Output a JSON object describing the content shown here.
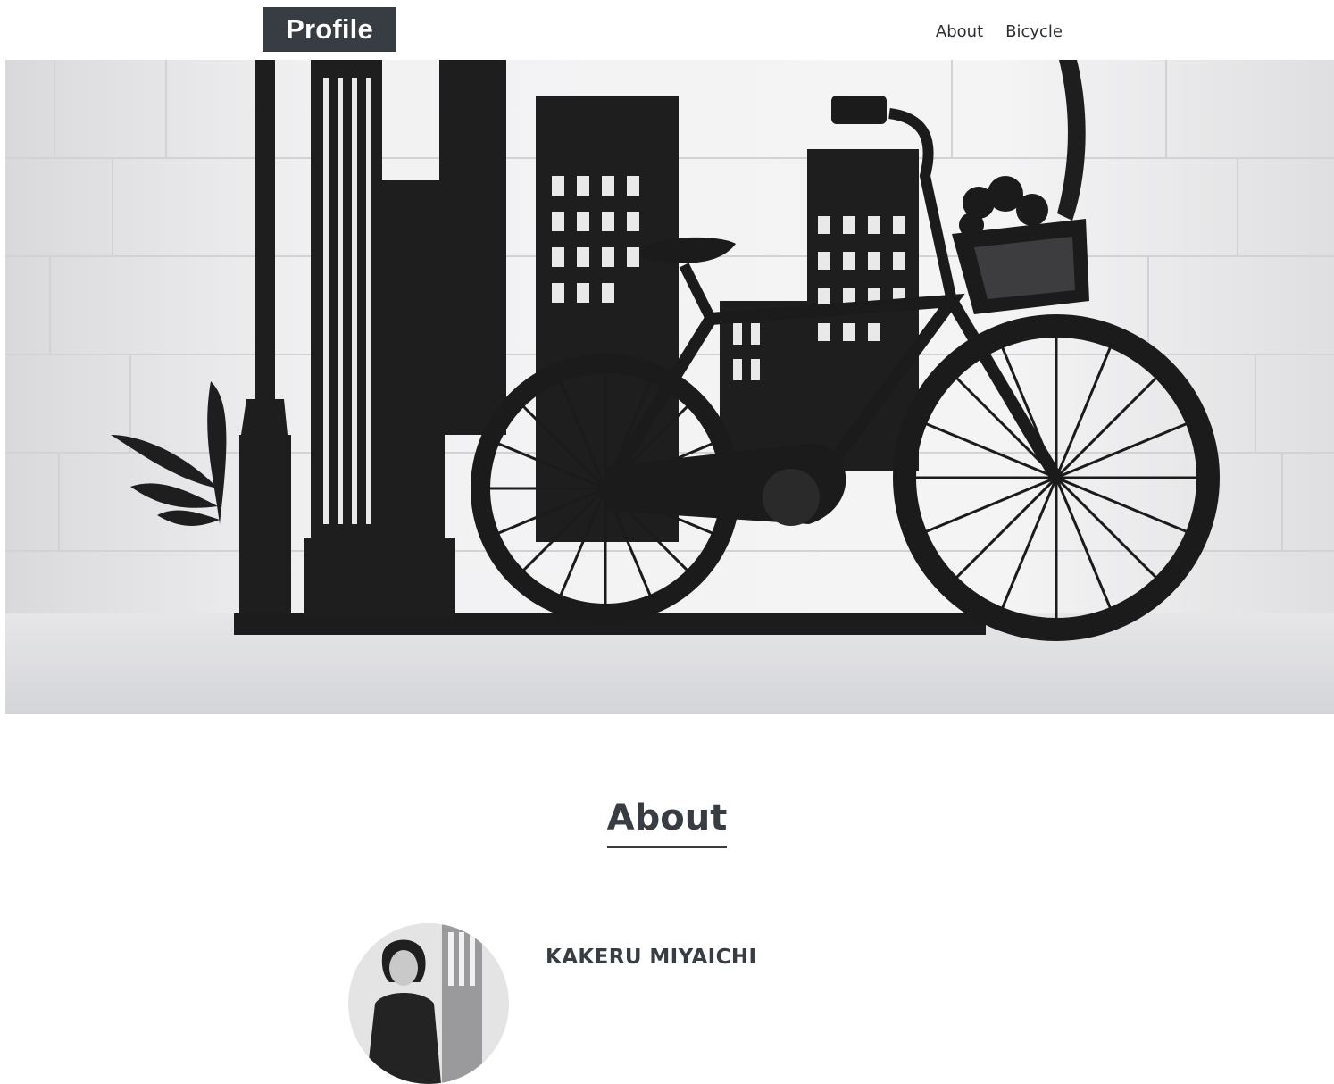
{
  "header": {
    "logo_text": "Profile",
    "nav": [
      {
        "label": "About"
      },
      {
        "label": "Bicycle"
      }
    ]
  },
  "hero": {
    "image": "black paper-cut silhouette of a city skyline and a bicycle with a flower basket against a white brick wall"
  },
  "about": {
    "heading": "About",
    "name": "KAKERU MIYAICHI"
  },
  "colors": {
    "dark": "#383c43",
    "text": "#2b2e33",
    "background": "#ffffff"
  }
}
